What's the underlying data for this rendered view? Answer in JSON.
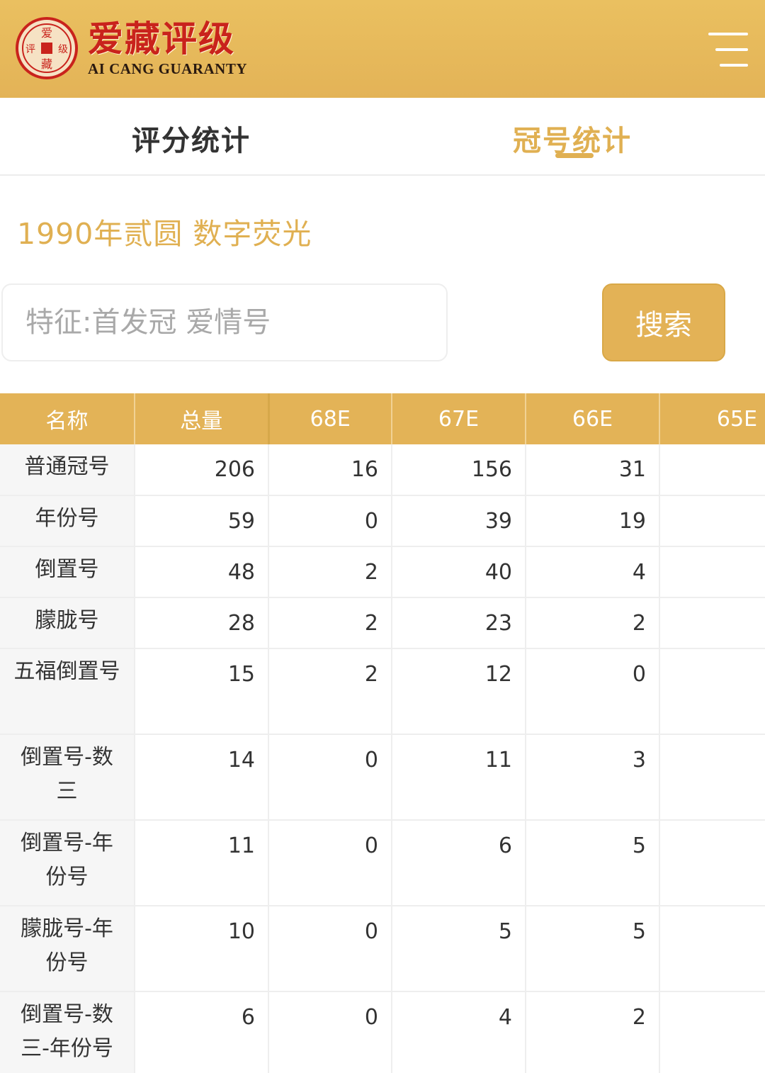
{
  "header": {
    "brand_cn": "爱藏评级",
    "brand_en": "AI CANG GUARANTY",
    "logo_chars": [
      "爱",
      "藏",
      "评",
      "级"
    ],
    "accent_color": "#e3b357",
    "brand_red": "#c9231c"
  },
  "tabs": [
    {
      "label": "评分统计",
      "active": false
    },
    {
      "label": "冠号统计",
      "active": true
    }
  ],
  "title": "1990年贰圆 数字荧光",
  "search": {
    "placeholder": "特征:首发冠 爱情号",
    "value": "",
    "button_label": "搜索"
  },
  "table": {
    "headers": [
      "名称",
      "总量",
      "68E",
      "67E",
      "66E",
      "65E"
    ],
    "rows": [
      {
        "name": "普通冠号",
        "values": [
          "206",
          "16",
          "156",
          "31",
          ""
        ]
      },
      {
        "name": "年份号",
        "values": [
          "59",
          "0",
          "39",
          "19",
          ""
        ]
      },
      {
        "name": "倒置号",
        "values": [
          "48",
          "2",
          "40",
          "4",
          ""
        ]
      },
      {
        "name": "朦胧号",
        "values": [
          "28",
          "2",
          "23",
          "2",
          ""
        ]
      },
      {
        "name": "五福倒置号",
        "values": [
          "15",
          "2",
          "12",
          "0",
          ""
        ]
      },
      {
        "name": "倒置号-数三",
        "values": [
          "14",
          "0",
          "11",
          "3",
          ""
        ]
      },
      {
        "name": "倒置号-年份号",
        "values": [
          "11",
          "0",
          "6",
          "5",
          ""
        ]
      },
      {
        "name": "朦胧号-年份号",
        "values": [
          "10",
          "0",
          "5",
          "5",
          ""
        ]
      },
      {
        "name": "倒置号-数三-年份号",
        "values": [
          "6",
          "0",
          "4",
          "2",
          ""
        ]
      }
    ]
  }
}
